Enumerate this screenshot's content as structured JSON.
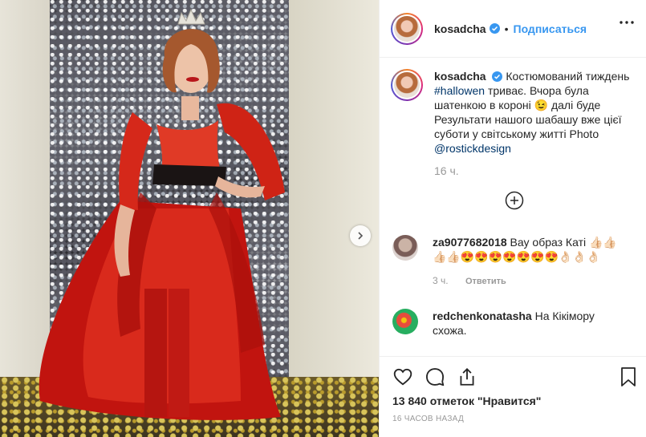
{
  "post": {
    "username": "kosadcha",
    "follow_label": "Подписаться",
    "dot": "•",
    "caption": {
      "username": "kosadcha",
      "text_before": "Костюмований тиждень ",
      "hashtag": "#hallowen",
      "text_after": " триває. Вчора була шатенкою в короні 😉 далі буде Результати нашого шабашу вже цієї суботи у світському житті Photo ",
      "mention": "@rostickdesign",
      "time": "16 ч."
    },
    "comments": [
      {
        "username": "za9077682018",
        "text": "Вау образ Каті 👍🏻👍🏻👍🏻👍🏻😍😍😍😍😍😍😍👌🏻👌🏻👌🏻",
        "time": "3 ч.",
        "reply_label": "Ответить"
      },
      {
        "username": "redchenkonatasha",
        "text": "На Кікімору схожа."
      }
    ],
    "likes": "13 840 отметок \"Нравится\"",
    "time_ago": "16 ЧАСОВ НАЗАД"
  },
  "icons": {
    "verified": "verified-badge-icon",
    "more": "more-options-icon",
    "load_more": "add-circle-icon",
    "like": "heart-icon",
    "comment": "comment-icon",
    "share": "share-icon",
    "save": "bookmark-icon",
    "next": "chevron-right-icon"
  },
  "colors": {
    "accent": "#3897f0",
    "link": "#003569",
    "muted": "#999999",
    "verified": "#3897f0"
  }
}
